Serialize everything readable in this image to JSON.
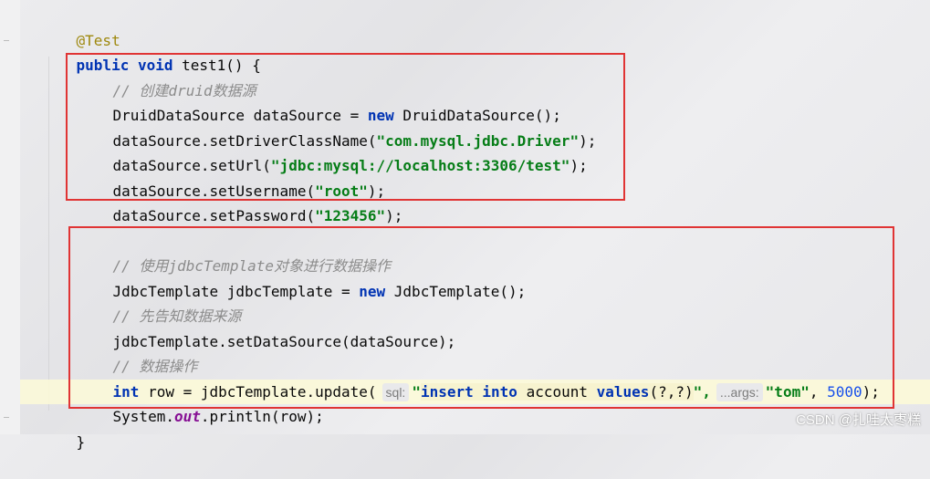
{
  "code": {
    "annotation": "@Test",
    "signature_kw1": "public",
    "signature_kw2": "void",
    "signature_rest": " test1() {",
    "comment_druid": "// 创建druid数据源",
    "druid_decl_a": "DruidDataSource dataSource = ",
    "new_kw": "new",
    "druid_decl_b": " DruidDataSource();",
    "set_driver_a": "dataSource.setDriverClassName(",
    "driver_str": "\"com.mysql.jdbc.Driver\"",
    "set_close": ");",
    "set_url_a": "dataSource.setUrl(",
    "url_str": "\"jdbc:mysql://localhost:3306/test\"",
    "set_user_a": "dataSource.setUsername(",
    "user_str": "\"root\"",
    "set_pass_a": "dataSource.setPassword(",
    "pass_str": "\"123456\"",
    "comment_template": "// 使用jdbcTemplate对象进行数据操作",
    "tpl_decl_a": "JdbcTemplate jdbcTemplate = ",
    "tpl_decl_b": " JdbcTemplate();",
    "comment_source": "// 先告知数据来源",
    "set_ds": "jdbcTemplate.setDataSource(dataSource);",
    "comment_op": "// 数据操作",
    "int_kw": "int",
    "update_a": " row = jdbcTemplate.update(",
    "hint_sql": "sql:",
    "sql_q_open": "\"",
    "sql_insert": "insert",
    "sql_into": "into",
    "sql_account": " account ",
    "sql_values": "values",
    "sql_params": "(?,?)",
    "sql_q_close": "\",",
    "hint_args": "...args:",
    "tom_str": "\"tom\"",
    "comma": ", ",
    "num_5000": "5000",
    "print_a": "System.",
    "out_field": "out",
    "print_b": ".println(row);",
    "close_brace": "}"
  },
  "watermark": "CSDN @扎哇太枣糕"
}
